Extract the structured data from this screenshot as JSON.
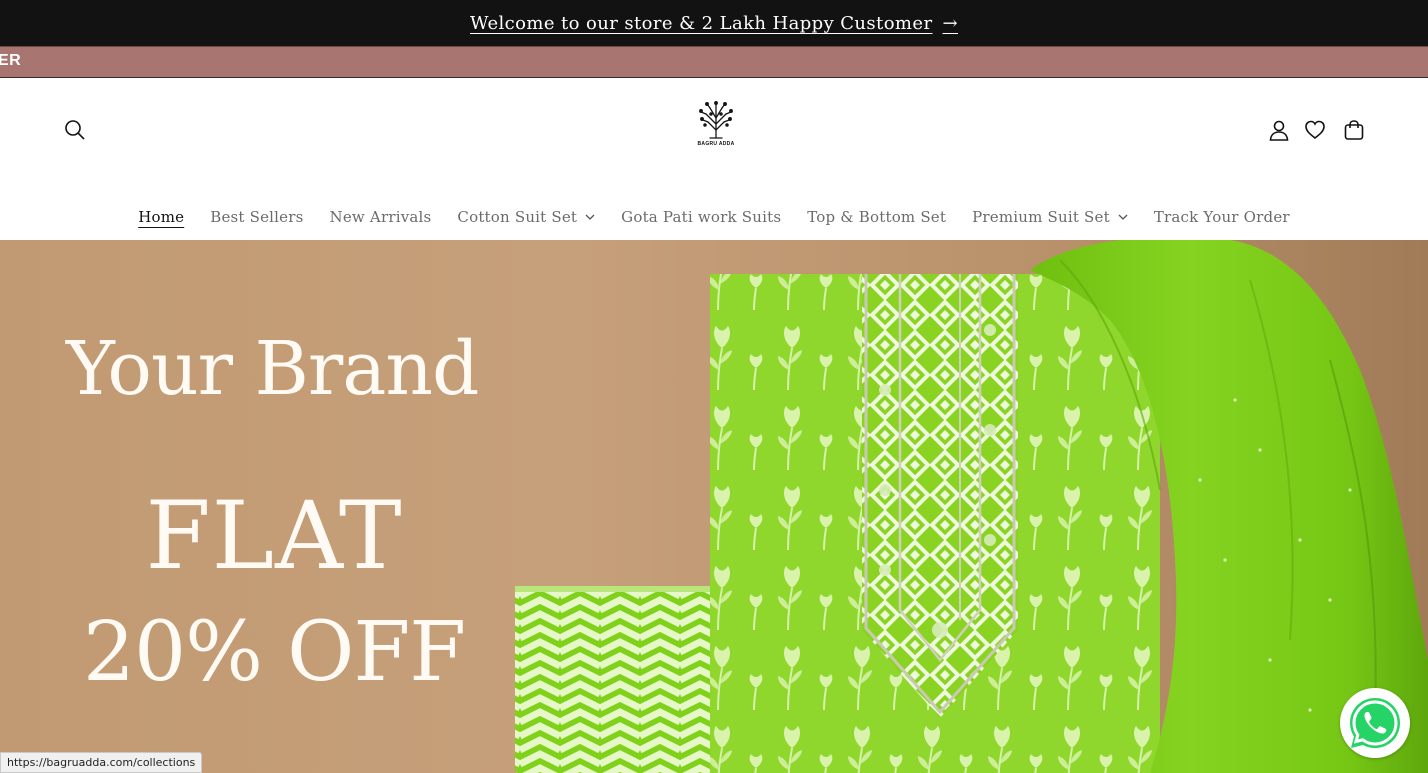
{
  "announcement": {
    "text": "Welcome to our store & 2 Lakh Happy Customer",
    "arrow": "→"
  },
  "marquee": {
    "text": "ER"
  },
  "header": {
    "logo_text": "BAGRU ADDA",
    "icons": [
      "search-icon",
      "account-icon",
      "wishlist-heart-icon",
      "cart-icon"
    ]
  },
  "nav": {
    "items": [
      {
        "label": "Home",
        "active": true,
        "has_dropdown": false
      },
      {
        "label": "Best Sellers",
        "active": false,
        "has_dropdown": false
      },
      {
        "label": "New Arrivals",
        "active": false,
        "has_dropdown": false
      },
      {
        "label": "Cotton Suit Set",
        "active": false,
        "has_dropdown": true
      },
      {
        "label": "Gota Pati work Suits",
        "active": false,
        "has_dropdown": false
      },
      {
        "label": "Top & Bottom Set",
        "active": false,
        "has_dropdown": false
      },
      {
        "label": "Premium Suit Set",
        "active": false,
        "has_dropdown": true
      },
      {
        "label": "Track Your Order",
        "active": false,
        "has_dropdown": false
      }
    ]
  },
  "hero": {
    "brand": "Your Brand",
    "flat": "FLAT",
    "offer": "20% OFF",
    "colors": {
      "background": "#c19a73",
      "fabric_green": "#8ed62a",
      "dupatta_green": "#7cc71a"
    }
  },
  "status_bar": {
    "url": "https://bagruadda.com/collections"
  },
  "whatsapp": {
    "icon": "whatsapp-icon",
    "color": "#25d366"
  }
}
